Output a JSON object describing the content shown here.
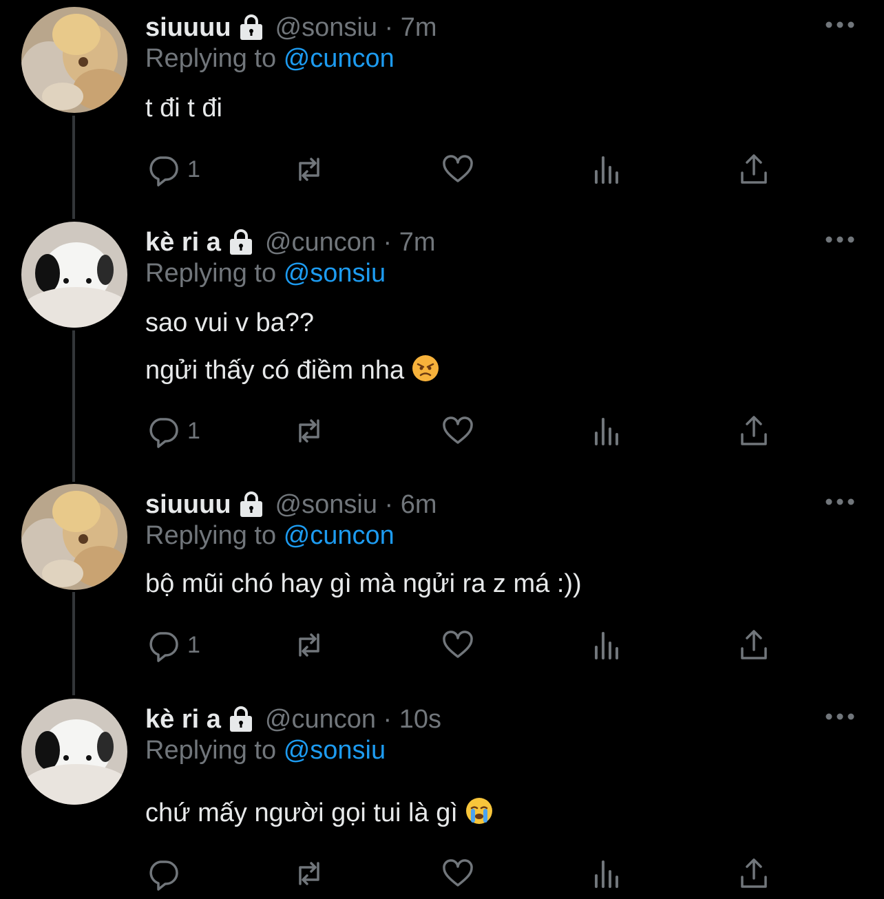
{
  "colors": {
    "background": "#000000",
    "primary_text": "#e7e9ea",
    "secondary_text": "#71767b",
    "mention": "#1d9bf0",
    "thread_line": "#333639"
  },
  "tweets": [
    {
      "display_name": "siuuuu",
      "handle_time": "@sonsiu · 7m",
      "replying_prefix": "Replying to",
      "replying_to": "@cuncon",
      "lines": [
        "t đi t đi"
      ],
      "reply_count": "1",
      "avatar": "plush-bear-avatar"
    },
    {
      "display_name": "kè ri a",
      "handle_time": "@cuncon · 7m",
      "replying_prefix": "Replying to",
      "replying_to": "@sonsiu",
      "lines": [
        "sao vui v ba??",
        "ngửi thấy có điềm nha"
      ],
      "emoji": "angry-face-emoji",
      "reply_count": "1",
      "avatar": "plush-puppy-avatar"
    },
    {
      "display_name": "siuuuu",
      "handle_time": "@sonsiu · 6m",
      "replying_prefix": "Replying to",
      "replying_to": "@cuncon",
      "lines": [
        "bộ mũi chó hay gì mà ngửi ra z má :))"
      ],
      "reply_count": "1",
      "avatar": "plush-bear-avatar"
    },
    {
      "display_name": "kè ri a",
      "handle_time": "@cuncon · 10s",
      "replying_prefix": "Replying to",
      "replying_to": "@sonsiu",
      "lines": [
        "chứ mấy người gọi tui là gì"
      ],
      "emoji": "crying-face-emoji",
      "reply_count": "",
      "avatar": "plush-puppy-avatar"
    }
  ],
  "icons": {
    "reply": "reply-icon",
    "retweet": "retweet-icon",
    "like": "heart-icon",
    "views": "views-icon",
    "share": "share-icon",
    "more": "more-icon",
    "lock": "lock-icon"
  }
}
